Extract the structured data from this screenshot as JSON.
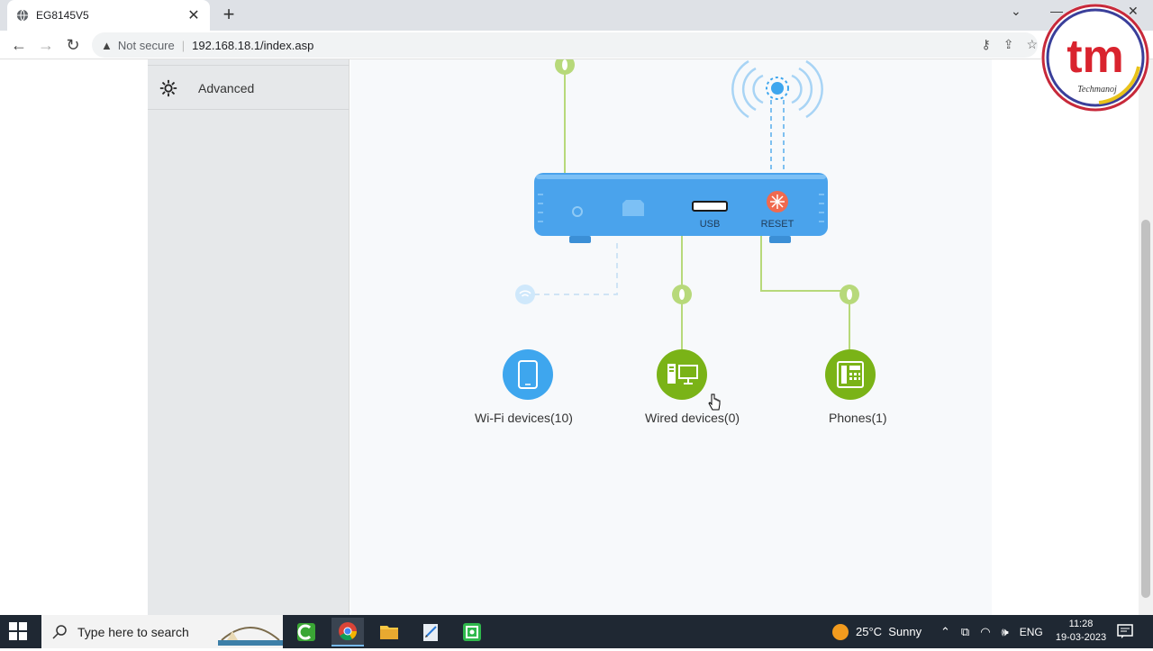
{
  "browser": {
    "tab_title": "EG8145V5",
    "security_label": "Not secure",
    "url": "192.168.18.1/index.asp"
  },
  "sidebar": {
    "items": [
      {
        "label": "Advanced",
        "icon": "gear-icon"
      }
    ]
  },
  "diagram": {
    "router": {
      "usb_label": "USB",
      "reset_label": "RESET"
    },
    "devices": [
      {
        "label": "Wi-Fi devices(10)",
        "icon": "tablet-icon",
        "color": "#3ea6ee"
      },
      {
        "label": "Wired devices(0)",
        "icon": "desktop-computer-icon",
        "color": "#7ab317"
      },
      {
        "label": "Phones(1)",
        "icon": "telephone-icon",
        "color": "#7ab317"
      }
    ],
    "colors": {
      "router": "#4aa3ec",
      "wired_line": "#b7d97a",
      "wifi_line": "#a8d4f5",
      "reset": "#f06a4f"
    }
  },
  "taskbar": {
    "search_placeholder": "Type here to search",
    "weather": "25°C  Sunny",
    "language": "ENG",
    "time": "11:28",
    "date": "19-03-2023"
  },
  "logo": {
    "text": "tm",
    "caption": "Techmanoj"
  }
}
